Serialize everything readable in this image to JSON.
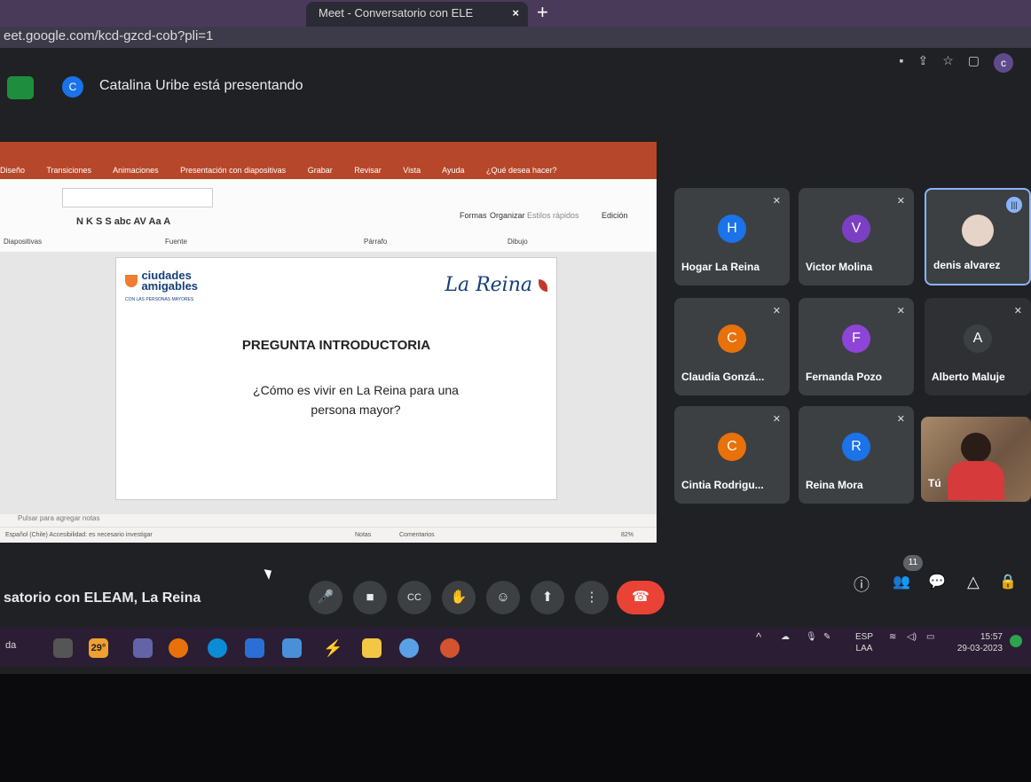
{
  "browser": {
    "tab_title": "Meet - Conversatorio con ELE",
    "tab_close": "×",
    "new_tab": "+",
    "url": "eet.google.com/kcd-gzcd-cob?pli=1"
  },
  "meet": {
    "presenter_initial": "C",
    "presenting_text": "Catalina Uribe está presentando",
    "meeting_name": "satorio con ELEAM, La Reina",
    "participant_count": "11"
  },
  "ppt": {
    "menu": [
      "Diseño",
      "Transiciones",
      "Animaciones",
      "Presentación con diapositivas",
      "Grabar",
      "Revisar",
      "Vista",
      "Ayuda",
      "¿Qué desea hacer?"
    ],
    "ribbon_groups": [
      "Fuente",
      "Párrafo",
      "Dibujo"
    ],
    "ribbon_buttons": [
      "Formas",
      "Organizar",
      "Estilos rápidos",
      "Edición"
    ],
    "ribbon_left": "Diapositivas",
    "font_buttons": "N   K   S   S   abc   AV   Aa   A",
    "notes_placeholder": "Pulsar para agregar notas",
    "status_left": "Español (Chile)     Accesibilidad: es necesario investigar",
    "status_notes": "Notas",
    "status_comments": "Comentarios",
    "zoom": "82%"
  },
  "slide": {
    "logo_left_line1": "ciudades",
    "logo_left_line2": "amigables",
    "logo_left_sub": "CON LAS PERSONAS MAYORES",
    "logo_right": "La Reina",
    "title": "PREGUNTA INTRODUCTORIA",
    "question_line1": "¿Cómo es vivir en La Reina para una",
    "question_line2": "persona mayor?"
  },
  "participants": [
    {
      "initial": "H",
      "name": "Hogar La Reina",
      "color": "#1a73e8"
    },
    {
      "initial": "V",
      "name": "Victor Molina",
      "color": "#7b3fc4"
    },
    {
      "initial": "",
      "name": "denis alvarez",
      "color": ""
    },
    {
      "initial": "C",
      "name": "Claudia Gonzá...",
      "color": "#e8710a"
    },
    {
      "initial": "F",
      "name": "Fernanda Pozo",
      "color": "#8e44d6"
    },
    {
      "initial": "A",
      "name": "Alberto Maluje",
      "color": "#3c4043"
    },
    {
      "initial": "C",
      "name": "Cintia Rodrigu...",
      "color": "#e8710a"
    },
    {
      "initial": "R",
      "name": "Reina Mora",
      "color": "#1a73e8"
    },
    {
      "initial": "",
      "name": "Tú",
      "color": ""
    }
  ],
  "taskbar": {
    "search_label": "da",
    "weather": "29°",
    "language_line1": "ESP",
    "language_line2": "LAA",
    "time": "15:57",
    "date": "29-03-2023"
  },
  "icons": {
    "mic": "🎤",
    "camera": "■",
    "captions": "CC",
    "hand": "✋",
    "emoji": "☺",
    "present": "⬆",
    "more": "⋮",
    "hangup": "☎",
    "info": "ⓘ",
    "people": "👥",
    "chat": "💬",
    "activities": "△",
    "lock": "🔒",
    "muted": "✕"
  }
}
